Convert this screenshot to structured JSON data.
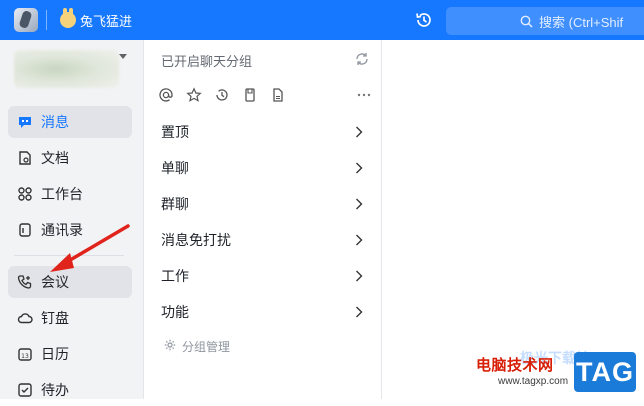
{
  "topbar": {
    "team_name": "兔飞猛进",
    "search_placeholder": "搜索 (Ctrl+Shif",
    "accent_color": "#1677ff"
  },
  "sidebar": {
    "items": [
      {
        "label": "消息",
        "icon": "message-icon",
        "active": true
      },
      {
        "label": "文档",
        "icon": "document-icon"
      },
      {
        "label": "工作台",
        "icon": "workbench-icon"
      },
      {
        "label": "通讯录",
        "icon": "contacts-icon"
      },
      {
        "label": "会议",
        "icon": "meeting-phone-icon",
        "active": true
      },
      {
        "label": "钉盘",
        "icon": "cloud-drive-icon"
      },
      {
        "label": "日历",
        "icon": "calendar-icon"
      },
      {
        "label": "待办",
        "icon": "todo-icon"
      }
    ]
  },
  "middle": {
    "title": "已开启聊天分组",
    "filter_icons": [
      "at-icon",
      "star-icon",
      "clock-icon",
      "bookmark-icon",
      "file-icon",
      "more-icon"
    ],
    "groups": [
      {
        "label": "置顶"
      },
      {
        "label": "单聊"
      },
      {
        "label": "群聊"
      },
      {
        "label": "消息免打扰"
      },
      {
        "label": "工作"
      },
      {
        "label": "功能"
      }
    ],
    "manage_label": "分组管理"
  },
  "watermark": {
    "site_name": "电脑技术网",
    "site_url": "www.tagxp.com",
    "tag_label": "TAG",
    "faded_text": "极光下载站"
  }
}
